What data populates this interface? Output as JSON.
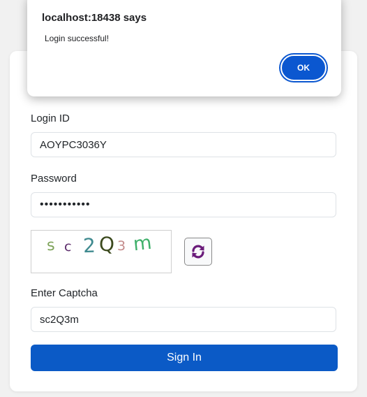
{
  "dialog": {
    "title": "localhost:18438 says",
    "message": "Login successful!",
    "ok_label": "OK"
  },
  "form": {
    "login_id_label": "Login ID",
    "login_id_value": "AOYPC3036Y",
    "password_label": "Password",
    "password_value": "•••••••••••",
    "captcha_chars": [
      {
        "ch": "s",
        "color": "#7ea35a"
      },
      {
        "ch": "c",
        "color": "#5b2a6a"
      },
      {
        "ch": "2",
        "color": "#3f8a8f"
      },
      {
        "ch": "Q",
        "color": "#3c4a1e"
      },
      {
        "ch": "3",
        "color": "#c48a8a"
      },
      {
        "ch": "m",
        "color": "#3fb06a"
      }
    ],
    "refresh_icon": "refresh-icon",
    "refresh_icon_color": "#6a1b7a",
    "captcha_label": "Enter Captcha",
    "captcha_value": "sc2Q3m",
    "signin_label": "Sign In"
  },
  "colors": {
    "primary": "#0b5ac6",
    "dialog_button": "#0b57d0"
  }
}
